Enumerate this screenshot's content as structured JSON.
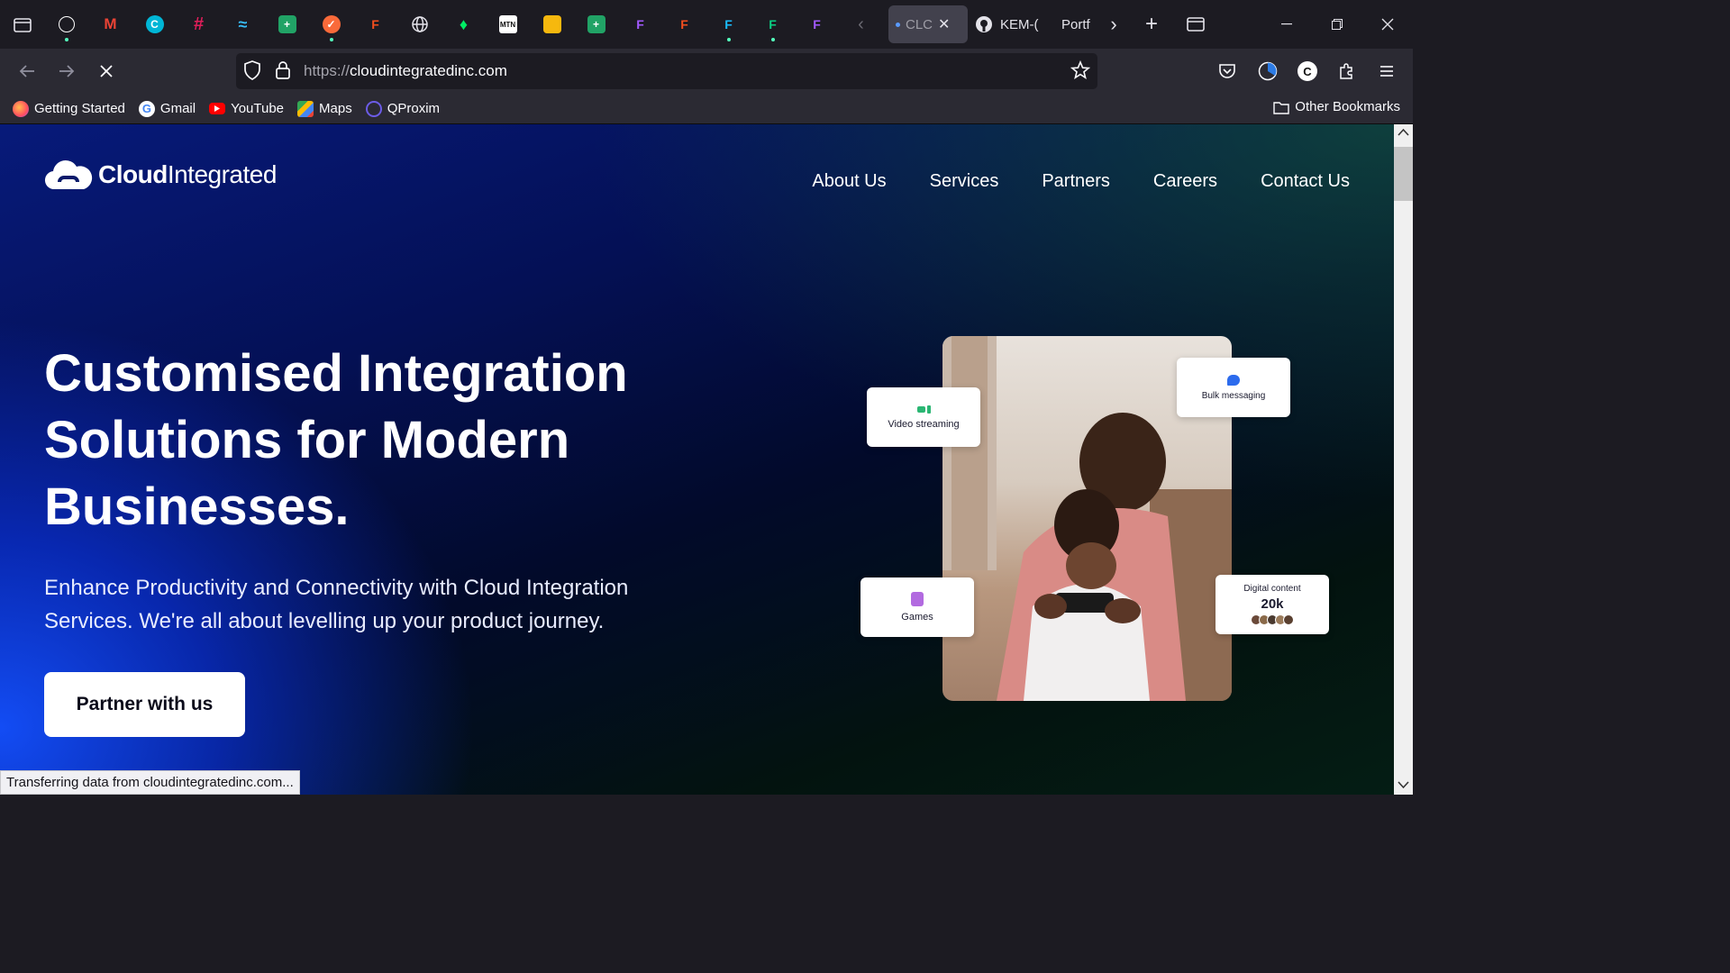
{
  "tabs": {
    "active_label": "CLC",
    "tab2_label": "KEM-(",
    "tab3_label": "Portf"
  },
  "navbar": {
    "url_proto": "https://",
    "url_host": "cloudintegratedinc.com"
  },
  "bookmarks": {
    "items": [
      "Getting Started",
      "Gmail",
      "YouTube",
      "Maps",
      "QProxim"
    ],
    "other": "Other Bookmarks"
  },
  "site": {
    "logo_bold": "Cloud",
    "logo_light": "Integrated",
    "nav": [
      "About Us",
      "Services",
      "Partners",
      "Careers",
      "Contact Us"
    ],
    "hero_title": "Customised Integration Solutions for Modern Businesses.",
    "hero_subtitle": "Enhance Productivity and Connectivity with Cloud Integration Services. We're all about levelling up your product journey.",
    "cta": "Partner with us",
    "cards": {
      "video": "Video streaming",
      "bulk": "Bulk messaging",
      "games": "Games",
      "digital_label": "Digital content",
      "digital_value": "20k"
    }
  },
  "status": "Transferring data from cloudintegratedinc.com..."
}
